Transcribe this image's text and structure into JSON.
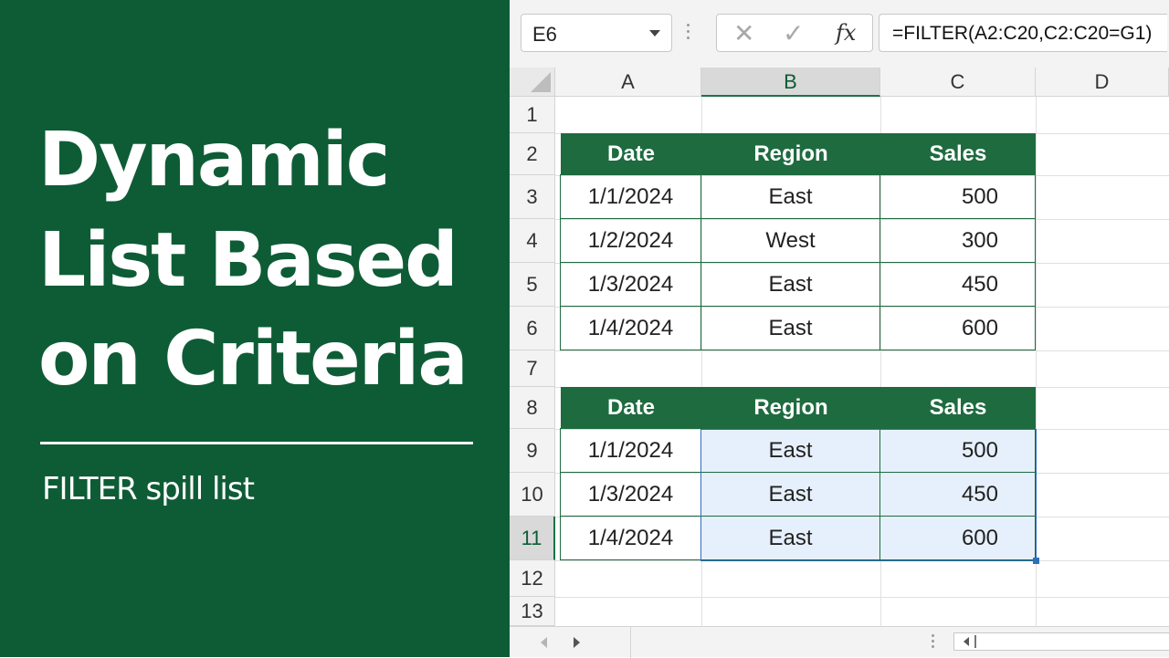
{
  "left_panel": {
    "title_lines": [
      "Dynamic",
      "List Based",
      "on Criteria"
    ],
    "subtitle": "FILTER spill list",
    "background": "#0e5c36"
  },
  "formula_bar": {
    "name_box": "E6",
    "cancel_icon": "✕",
    "enter_icon": "✓",
    "fx_label": "fx",
    "formula": "=FILTER(A2:C20,C2:C20=G1)"
  },
  "columns": [
    "A",
    "B",
    "C",
    "D"
  ],
  "rows": [
    "1",
    "2",
    "3",
    "4",
    "5",
    "6",
    "7",
    "8",
    "9",
    "10",
    "11",
    "12",
    "13"
  ],
  "source_table": {
    "headers": [
      "Date",
      "Region",
      "Sales"
    ],
    "rows": [
      [
        "1/1/2024",
        "East",
        "500"
      ],
      [
        "1/2/2024",
        "West",
        "300"
      ],
      [
        "1/3/2024",
        "East",
        "450"
      ],
      [
        "1/4/2024",
        "East",
        "600"
      ]
    ]
  },
  "result_table": {
    "headers": [
      "Date",
      "Region",
      "Sales"
    ],
    "rows": [
      [
        "1/1/2024",
        "East",
        "500"
      ],
      [
        "1/3/2024",
        "East",
        "450"
      ],
      [
        "1/4/2024",
        "East",
        "600"
      ]
    ]
  },
  "colors": {
    "header_green": "#1e6b40",
    "spill_fill": "#e6f0fc",
    "spill_border": "#2f6fb8"
  }
}
